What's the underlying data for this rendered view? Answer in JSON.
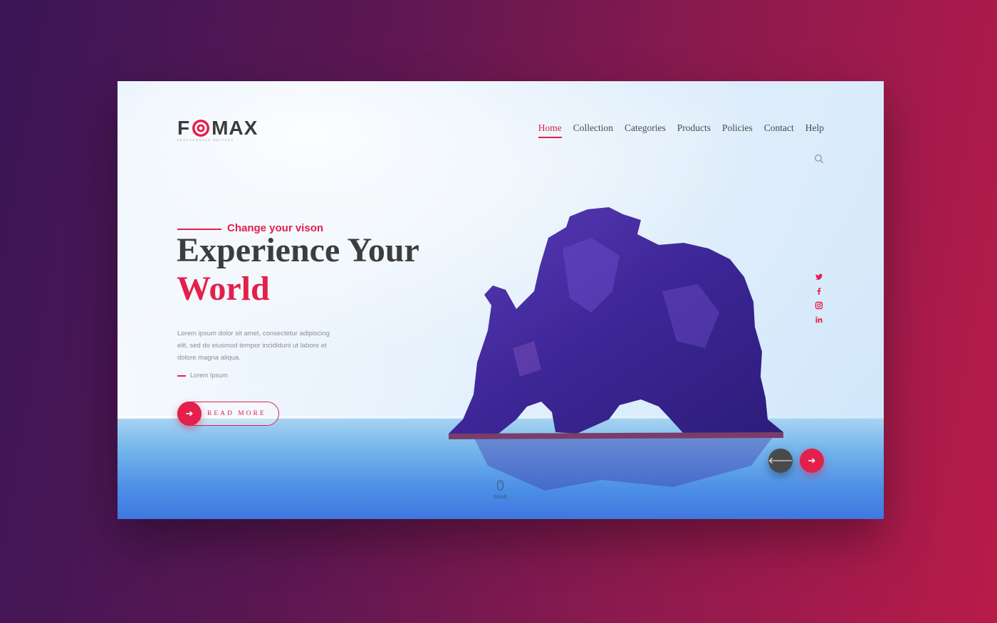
{
  "brand": {
    "name_left": "F",
    "name_right": "MAX",
    "tagline": "PERFORMANCE MATTERS",
    "accent_color": "#e3204b"
  },
  "nav": {
    "items": [
      {
        "label": "Home",
        "active": true
      },
      {
        "label": "Collection",
        "active": false
      },
      {
        "label": "Categories",
        "active": false
      },
      {
        "label": "Products",
        "active": false
      },
      {
        "label": "Policies",
        "active": false
      },
      {
        "label": "Contact",
        "active": false
      },
      {
        "label": "Help",
        "active": false
      }
    ],
    "search_icon": "search-icon"
  },
  "hero": {
    "eyebrow": "Change your vison",
    "title_line1": "Experience Your",
    "title_line2": "World",
    "lead": "Lorem ipsum dolor sit amet, consectetur adipiscing elit, sed do eiusmod tempor incididunt ut labore et dolore magna aliqua.",
    "sub_label": "Lorem Ipsum",
    "cta_label": "READ MORE",
    "cta_icon": "arrow-right-icon"
  },
  "social": [
    {
      "name": "twitter-icon",
      "glyph": "🐦"
    },
    {
      "name": "facebook-icon",
      "glyph": "f"
    },
    {
      "name": "instagram-icon",
      "glyph": "◘"
    },
    {
      "name": "linkedin-icon",
      "glyph": "in"
    }
  ],
  "slider": {
    "prev_icon": "arrow-left-icon",
    "next_icon": "arrow-right-icon",
    "scroll_label": "Scroll"
  }
}
